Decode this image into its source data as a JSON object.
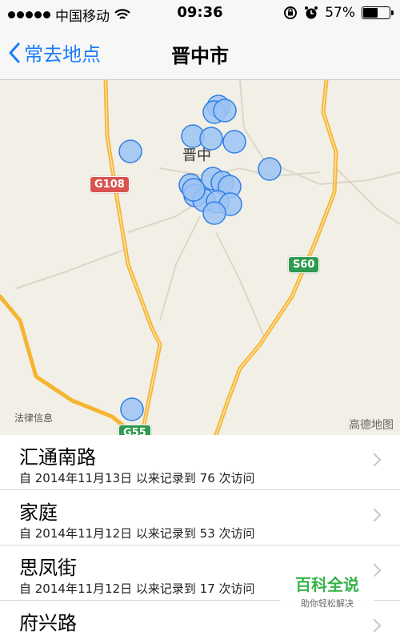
{
  "status_bar": {
    "carrier": "中国移动",
    "time": "09:36",
    "battery": "57%",
    "battery_level": 0.57
  },
  "nav": {
    "back_label": "常去地点",
    "title": "晋中市"
  },
  "map": {
    "city_label": "晋中",
    "roads": {
      "g108": "G108",
      "s60": "S60",
      "g55": "G55"
    },
    "legal": "法律信息",
    "logo": "高德地图"
  },
  "locations": [
    {
      "name": "汇通南路",
      "subtitle": "自 2014年11月13日 以来记录到 76 次访问"
    },
    {
      "name": "家庭",
      "subtitle": "自 2014年11月12日 以来记录到 53 次访问"
    },
    {
      "name": "思凤街",
      "subtitle": "自 2014年11月12日 以来记录到 17 次访问"
    },
    {
      "name": "府兴路",
      "subtitle": ""
    }
  ],
  "watermark": {
    "title": "百科全说",
    "subtitle": "助你轻松解决"
  },
  "colors": {
    "accent": "#1a7ef7",
    "road": "#f6b530",
    "marker_fill": "#9cc3f3",
    "marker_stroke": "#2f7fe6"
  },
  "icons": [
    "signal-dots-icon",
    "wifi-icon",
    "rotation-lock-icon",
    "alarm-icon",
    "battery-icon",
    "back-chevron-icon",
    "disclosure-chevron-icon",
    "location-marker-icon"
  ]
}
